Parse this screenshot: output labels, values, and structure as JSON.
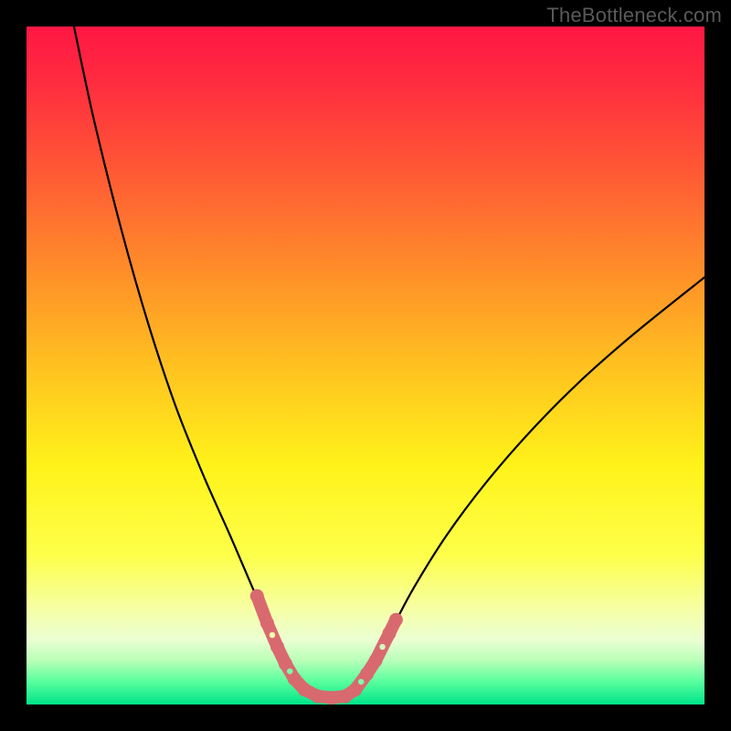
{
  "watermark": "TheBottleneck.com",
  "chart_data": {
    "type": "line",
    "title": "",
    "xlabel": "",
    "ylabel": "",
    "xlim": [
      0,
      100
    ],
    "ylim": [
      0,
      100
    ],
    "grid": false,
    "legend": false,
    "note": "Axis values are normalized 0–100; the figure has no numeric tick labels, so values below are positional estimates.",
    "gradient_stops": [
      {
        "offset": 0.0,
        "color": "#ff1744"
      },
      {
        "offset": 0.08,
        "color": "#ff2b3f"
      },
      {
        "offset": 0.2,
        "color": "#ff5436"
      },
      {
        "offset": 0.35,
        "color": "#ff8a2a"
      },
      {
        "offset": 0.5,
        "color": "#ffc120"
      },
      {
        "offset": 0.65,
        "color": "#fff31a"
      },
      {
        "offset": 0.78,
        "color": "#fdff4a"
      },
      {
        "offset": 0.86,
        "color": "#f6ffa6"
      },
      {
        "offset": 0.905,
        "color": "#eaffd2"
      },
      {
        "offset": 0.935,
        "color": "#b8ffb8"
      },
      {
        "offset": 0.965,
        "color": "#5cff9e"
      },
      {
        "offset": 1.0,
        "color": "#00e58a"
      }
    ],
    "series": [
      {
        "name": "curve-left",
        "stroke": "#000000",
        "x": [
          7,
          10,
          14,
          18,
          22,
          26,
          30,
          33,
          35,
          37,
          38.5,
          40,
          42,
          44,
          46
        ],
        "y": [
          100,
          86,
          70,
          56,
          44,
          34,
          25,
          18,
          13.5,
          9.5,
          6.5,
          4.0,
          2.0,
          1.0,
          1.0
        ]
      },
      {
        "name": "curve-right",
        "stroke": "#000000",
        "x": [
          46,
          48,
          50,
          53,
          57,
          62,
          68,
          75,
          82,
          90,
          100
        ],
        "y": [
          1.0,
          2.0,
          4.5,
          9.5,
          17,
          25,
          33,
          41,
          48,
          55,
          63
        ]
      },
      {
        "name": "marker-band",
        "stroke": "#d86a6f",
        "style": "thick-dashed",
        "points": [
          {
            "x": 34.0,
            "y": 16.0
          },
          {
            "x": 35.5,
            "y": 12.0
          },
          {
            "x": 37.0,
            "y": 8.5
          },
          {
            "x": 38.2,
            "y": 6.0
          },
          {
            "x": 39.5,
            "y": 3.8
          },
          {
            "x": 41.0,
            "y": 2.2
          },
          {
            "x": 43.0,
            "y": 1.2
          },
          {
            "x": 45.0,
            "y": 1.0
          },
          {
            "x": 47.0,
            "y": 1.2
          },
          {
            "x": 48.5,
            "y": 2.2
          },
          {
            "x": 50.2,
            "y": 4.5
          },
          {
            "x": 51.5,
            "y": 6.5
          },
          {
            "x": 53.5,
            "y": 10.5
          },
          {
            "x": 54.5,
            "y": 12.5
          }
        ]
      }
    ]
  }
}
